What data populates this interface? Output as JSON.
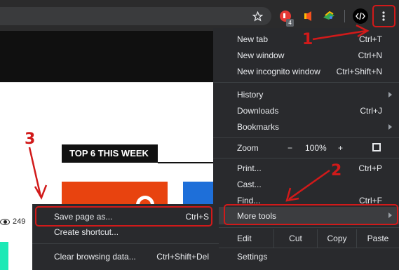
{
  "toolbar": {
    "icons": [
      "star-icon",
      "extension-icon",
      "extension-icon",
      "extension-icon",
      "code-icon",
      "more-vert-icon"
    ],
    "badge_count": "4"
  },
  "page": {
    "heading": "TOP 6 THIS WEEK",
    "views": "249"
  },
  "menu": {
    "new_tab": {
      "label": "New tab",
      "shortcut": "Ctrl+T"
    },
    "new_window": {
      "label": "New window",
      "shortcut": "Ctrl+N"
    },
    "incognito": {
      "label": "New incognito window",
      "shortcut": "Ctrl+Shift+N"
    },
    "history": {
      "label": "History"
    },
    "downloads": {
      "label": "Downloads",
      "shortcut": "Ctrl+J"
    },
    "bookmarks": {
      "label": "Bookmarks"
    },
    "zoom": {
      "label": "Zoom",
      "minus": "−",
      "value": "100%",
      "plus": "+"
    },
    "print": {
      "label": "Print...",
      "shortcut": "Ctrl+P"
    },
    "cast": {
      "label": "Cast..."
    },
    "find": {
      "label": "Find...",
      "shortcut": "Ctrl+F"
    },
    "more_tools": {
      "label": "More tools"
    },
    "edit": {
      "label": "Edit",
      "cut": "Cut",
      "copy": "Copy",
      "paste": "Paste"
    },
    "settings": {
      "label": "Settings"
    }
  },
  "submenu": {
    "save_page": {
      "label": "Save page as...",
      "shortcut": "Ctrl+S"
    },
    "create_shortcut": {
      "label": "Create shortcut..."
    },
    "clear_data": {
      "label": "Clear browsing data...",
      "shortcut": "Ctrl+Shift+Del"
    }
  },
  "annotations": {
    "step1": "1",
    "step2": "2",
    "step3": "3"
  },
  "colors": {
    "annotation": "#d11a1a",
    "menu_bg": "#292a2d",
    "toolbar_bg": "#2b2b2c"
  }
}
